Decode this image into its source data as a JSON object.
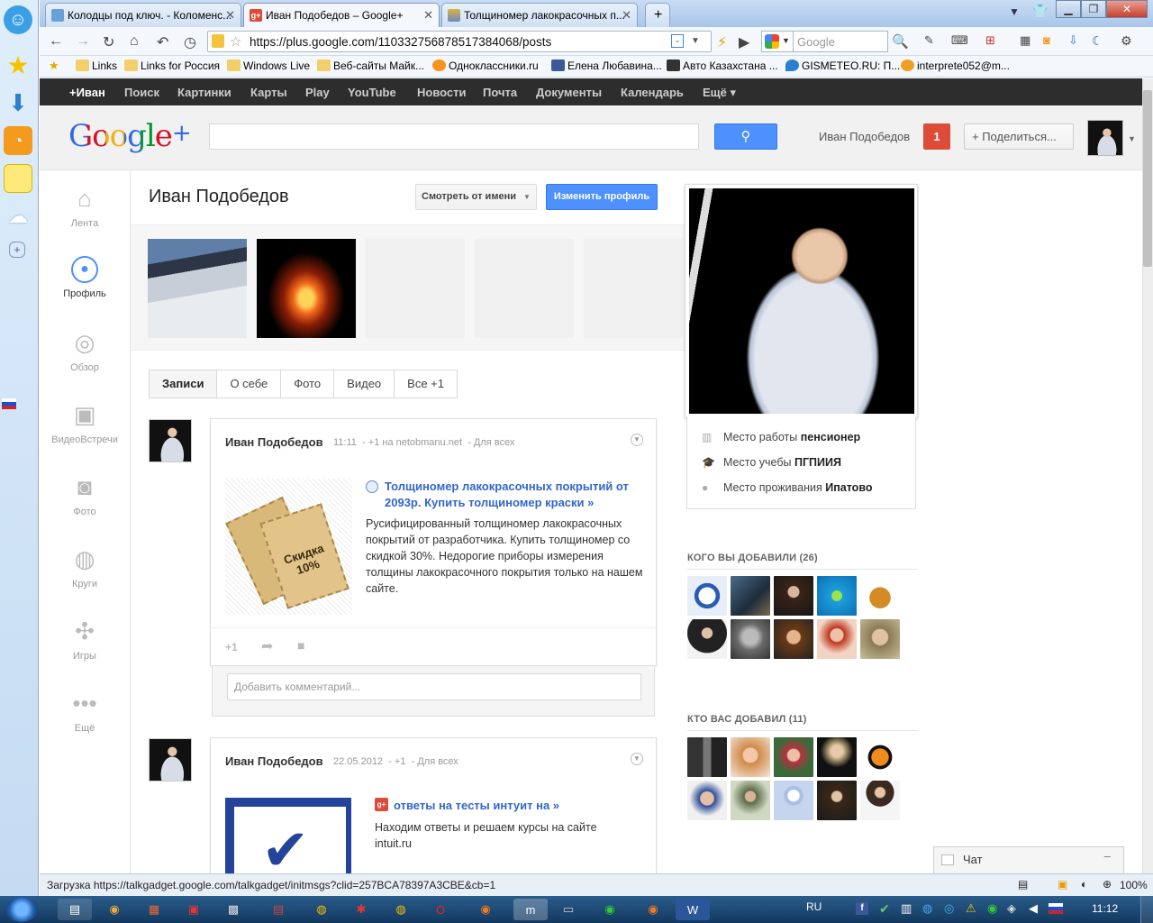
{
  "browser": {
    "tabs": [
      {
        "title": "Колодцы под ключ. - Коломенс..."
      },
      {
        "title": "Иван Подобедов – Google+"
      },
      {
        "title": "Толщиномер лакокрасочных п..."
      }
    ],
    "new_tab": "+",
    "url": "https://plus.google.com/110332756878517384068/posts",
    "search_placeholder": "Google",
    "bookmarks": [
      {
        "label": "Links"
      },
      {
        "label": "Links for Россия"
      },
      {
        "label": "Windows Live"
      },
      {
        "label": "Веб-сайты Майк..."
      },
      {
        "label": "Одноклассники.ru"
      },
      {
        "label": "Елена Любавина..."
      },
      {
        "label": "Авто Казахстана ..."
      },
      {
        "label": "GISMETEO.RU: П..."
      },
      {
        "label": "interprete052@m..."
      }
    ],
    "status": "Загрузка https://talkgadget.google.com/talkgadget/initmsgs?clid=257BCA78397A3CBE&cb=1",
    "zoom": "100%"
  },
  "gbar": [
    "+Иван",
    "Поиск",
    "Картинки",
    "Карты",
    "Play",
    "YouTube",
    "Новости",
    "Почта",
    "Документы",
    "Календарь",
    "Ещё ▾"
  ],
  "header": {
    "logo_google": "Google",
    "logo_plus": "+",
    "user_name": "Иван Подобедов",
    "notifications": "1",
    "share": "+ Поделиться..."
  },
  "leftnav": [
    {
      "label": "Лента"
    },
    {
      "label": "Профиль"
    },
    {
      "label": "Обзор"
    },
    {
      "label": "ВидеоВстречи"
    },
    {
      "label": "Фото"
    },
    {
      "label": "Круги"
    },
    {
      "label": "Игры"
    },
    {
      "label": "Ещё"
    }
  ],
  "profile": {
    "name": "Иван Подобедов",
    "view_as": "Смотреть от имени",
    "edit": "Изменить профиль",
    "tabs": [
      "Записи",
      "О себе",
      "Фото",
      "Видео",
      "Все +1"
    ]
  },
  "posts": [
    {
      "author": "Иван Подобедов",
      "time": "11:11",
      "via": "+1 на netobmanu.net",
      "sep": "-",
      "audience": "Для всех",
      "link_title": "Толщиномер лакокрасочных покрытий от 2093р. Купить толщиномер краски »",
      "description": "Русифицированный толщиномер лакокрасочных покрытий от разработчика. Купить толщиномер со скидкой 30%. Недорогие приборы измерения толщины лакокрасочного покрытия только на нашем сайте.",
      "ticket_text": "Скидка 10%",
      "plusone": "+1",
      "comment_placeholder": "Добавить комментарий..."
    },
    {
      "author": "Иван Подобедов",
      "time": "22.05.2012",
      "via": "+1",
      "sep": "-",
      "audience": "Для всех",
      "link_title": "ответы на тесты интуит на »",
      "description": "Находим ответы и решаем курсы на сайте intuit.ru"
    }
  ],
  "about": {
    "work_label": "Место работы",
    "work_value": "пенсионер",
    "edu_label": "Место учебы",
    "edu_value": "ПГПИИЯ",
    "home_label": "Место проживания",
    "home_value": "Ипатово"
  },
  "added": {
    "title": "КОГО ВЫ ДОБАВИЛИ (26)"
  },
  "added_you": {
    "title": "КТО ВАС ДОБАВИЛ (11)"
  },
  "chat": {
    "label": "Чат"
  },
  "taskbar": {
    "lang": "RU",
    "clock": "11:12"
  },
  "colors": {
    "accent": "#4d90fe",
    "notif": "#dd4b39",
    "gbar": "#2d2d2d",
    "link": "#3366cc"
  }
}
